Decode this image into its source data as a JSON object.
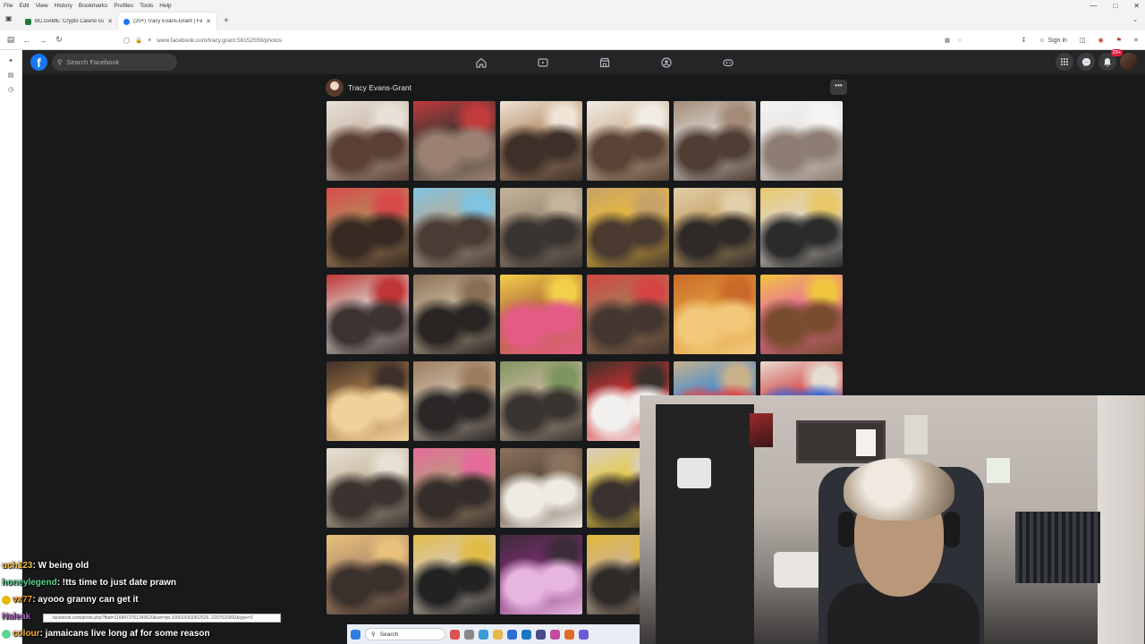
{
  "browser": {
    "menu": [
      "File",
      "Edit",
      "View",
      "History",
      "Bookmarks",
      "Profiles",
      "Tools",
      "Help"
    ],
    "tabs": [
      {
        "title": "BC.GAME: Crypto Casino Game",
        "color": "#1f7a3b",
        "active": false
      },
      {
        "title": "(20+) Tracy Evans-Grant | Faceb",
        "color": "#1877f2",
        "active": true
      }
    ],
    "new_tab": "+",
    "url": "www.facebook.com/tracy.grant.58152559/photos",
    "sign_in": "Sign in"
  },
  "facebook": {
    "search_placeholder": "Search Facebook",
    "notifications_badge": "20+",
    "profile_name": "Tracy Evans-Grant",
    "more_label": "•••"
  },
  "photos": [
    {
      "desc": "party-table",
      "colors": [
        "#c9b7a8",
        "#5a4036",
        "#e9e1d8"
      ]
    },
    {
      "desc": "dining-room",
      "colors": [
        "#3c3532",
        "#9a8172",
        "#c23b3b"
      ]
    },
    {
      "desc": "group-at-table",
      "colors": [
        "#b58e6c",
        "#3d3029",
        "#efe4d6"
      ]
    },
    {
      "desc": "women-table",
      "colors": [
        "#cfb69a",
        "#5a4437",
        "#f1ece6"
      ]
    },
    {
      "desc": "couple-standing",
      "colors": [
        "#d9d4cf",
        "#4f3e34",
        "#a38b77"
      ]
    },
    {
      "desc": "white-coats",
      "colors": [
        "#e6e4e2",
        "#8d7d72",
        "#f5f4f3"
      ]
    },
    {
      "desc": "dance-living",
      "colors": [
        "#b38a5a",
        "#362a22",
        "#d94b4b"
      ]
    },
    {
      "desc": "balloons-cake",
      "colors": [
        "#b9a996",
        "#4a3c34",
        "#7fc4e0"
      ]
    },
    {
      "desc": "sofa-group",
      "colors": [
        "#9c8975",
        "#3a3431",
        "#c4b49b"
      ]
    },
    {
      "desc": "yellow-hat",
      "colors": [
        "#e8bb3a",
        "#4a3a30",
        "#c7a36a"
      ]
    },
    {
      "desc": "woman-dancing",
      "colors": [
        "#c7a36a",
        "#2f2a28",
        "#e0cfa8"
      ]
    },
    {
      "desc": "pillow-80",
      "colors": [
        "#ded6cb",
        "#2b2b2b",
        "#e8c86a"
      ]
    },
    {
      "desc": "kitchen-woman",
      "colors": [
        "#d8d2cc",
        "#3f3232",
        "#c03535"
      ]
    },
    {
      "desc": "duo-posing",
      "colors": [
        "#c9b89c",
        "#2a2523",
        "#8a6f56"
      ]
    },
    {
      "desc": "balloon-room",
      "colors": [
        "#b26e3a",
        "#e45b86",
        "#f3d04a"
      ]
    },
    {
      "desc": "balloon-dining",
      "colors": [
        "#a47a57",
        "#443630",
        "#d64545"
      ]
    },
    {
      "desc": "orange-balloons",
      "colors": [
        "#e09a3c",
        "#f2c97a",
        "#c96a2a"
      ]
    },
    {
      "desc": "pink-balloons",
      "colors": [
        "#ea6c9f",
        "#7a4c2f",
        "#f0c53e"
      ]
    },
    {
      "desc": "chandelier-table",
      "colors": [
        "#a57a46",
        "#f1d19a",
        "#3f302a"
      ]
    },
    {
      "desc": "woman-stairs",
      "colors": [
        "#cdbda8",
        "#2b2727",
        "#9d7d60"
      ]
    },
    {
      "desc": "woman-plants",
      "colors": [
        "#cab79e",
        "#3a3431",
        "#7f955f"
      ]
    },
    {
      "desc": "red-hat-cake",
      "colors": [
        "#d63131",
        "#f1f0ee",
        "#3b2f2b"
      ]
    },
    {
      "desc": "balloons-blue",
      "colors": [
        "#3e8bd6",
        "#e04b4b",
        "#c9b18c"
      ]
    },
    {
      "desc": "red-balloons",
      "colors": [
        "#d64545",
        "#3e6ad6",
        "#e6ddd2"
      ]
    },
    {
      "desc": "hallway-group",
      "colors": [
        "#c8b89f",
        "#3a3330",
        "#e7e0d5"
      ]
    },
    {
      "desc": "staircase-balloons",
      "colors": [
        "#b99c7c",
        "#352d2a",
        "#e56c9a"
      ]
    },
    {
      "desc": "cousins-plaque",
      "colors": [
        "#5c4a3c",
        "#efeae3",
        "#8a735e"
      ]
    },
    {
      "desc": "yellow-shirt",
      "colors": [
        "#e8c93a",
        "#3b3230",
        "#d8cfc3"
      ]
    },
    {
      "desc": "",
      "colors": [
        "#000000",
        "#000000",
        "#000000"
      ]
    },
    {
      "desc": "",
      "colors": [
        "#000000",
        "#000000",
        "#000000"
      ]
    },
    {
      "desc": "couch-family",
      "colors": [
        "#b48c6c",
        "#3a302c",
        "#e8c27c"
      ]
    },
    {
      "desc": "sash-grandma",
      "colors": [
        "#d7c9b7",
        "#222222",
        "#e1bc4a"
      ]
    },
    {
      "desc": "79-balloon",
      "colors": [
        "#7a2d6e",
        "#e7b6e0",
        "#3d2b3a"
      ]
    },
    {
      "desc": "gift-table",
      "colors": [
        "#c9b29a",
        "#2e2a28",
        "#e2b83a"
      ]
    }
  ],
  "chat": [
    {
      "user": "uch123",
      "user_color": "#f0c040",
      "message": " : W being old"
    },
    {
      "user": "honeylegend",
      "user_color": "#58d68d",
      "message": " : !tts time to just date prawn"
    },
    {
      "user": "vx77",
      "user_color": "#f39c12",
      "message": " : ayooo granny can get it"
    },
    {
      "user": "Naleak",
      "user_color": "#a569bd",
      "message": ""
    },
    {
      "user": "colour",
      "user_color": "#f5b041",
      "message": " : jamaicans live long af for some reason"
    }
  ],
  "status_url": "facebook.com/photo.php?fbid=1168473761343620&set=pb.100014303302526.-2207520000&type=3",
  "taskbar": {
    "search_label": "Search"
  }
}
